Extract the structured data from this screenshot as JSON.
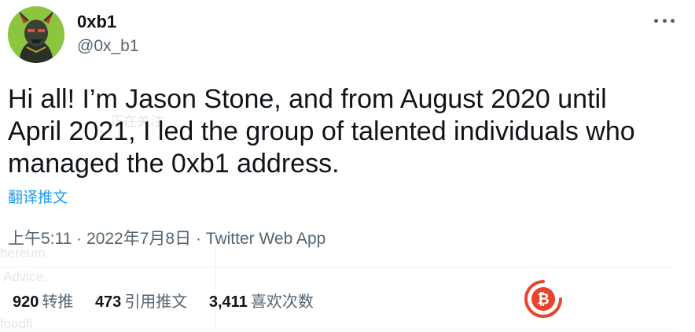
{
  "user": {
    "display_name": "0xb1",
    "handle": "@0x_b1"
  },
  "tweet": {
    "lines": [
      "Hi all! I’m Jason Stone, and from August 2020 until",
      "April 2021, I led the group of talented individuals who",
      "managed the 0xb1 address."
    ],
    "translate_label": "翻译推文",
    "time": "上午5:11",
    "separator": "·",
    "date": "2022年7月8日",
    "source": "Twitter Web App"
  },
  "stats": {
    "retweets": {
      "count": "920",
      "label": "转推"
    },
    "quotes": {
      "count": "473",
      "label": "引用推文"
    },
    "likes": {
      "count": "3,411",
      "label": "喜欢次数"
    }
  },
  "background_ghost_text": {
    "follow": "正在关注",
    "ethereum": "hereum",
    "advice": "Advice.",
    "foodfi": "foodfi"
  },
  "icons": {
    "more": "more-horizontal-icon",
    "watermark": "bitcoin-logo-icon"
  },
  "colors": {
    "text": "#0f1419",
    "secondary": "#536471",
    "link": "#1d9bf0",
    "avatar_bg": "#8cc63f",
    "watermark": "#e8452c"
  }
}
